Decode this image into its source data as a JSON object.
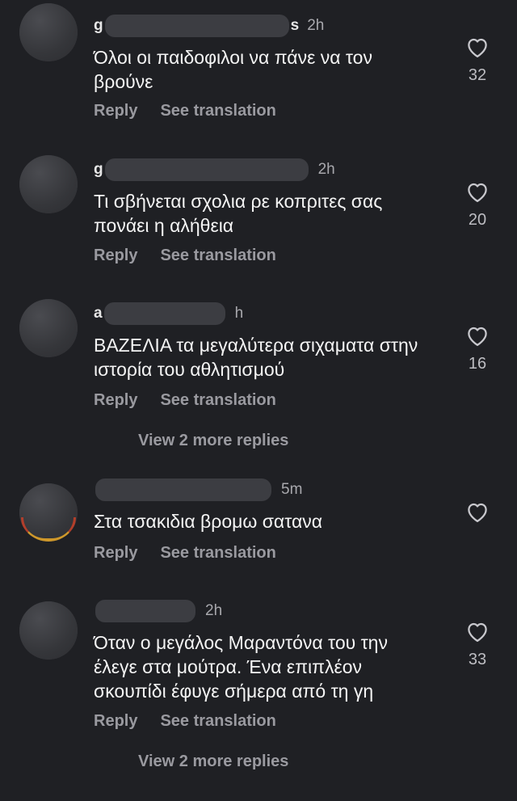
{
  "comments": [
    {
      "username_start": "g",
      "username_end": "s",
      "time": "2h",
      "text": "Όλοι οι παιδοφιλοι να πάνε να τον βρούνε",
      "reply": "Reply",
      "see_translation": "See translation",
      "likes": "32"
    },
    {
      "username_start": "g",
      "username_end": "",
      "time": "2h",
      "text": "Τι σβήνεται σχολια ρε κοπριτες σας πονάει η αλήθεια",
      "reply": "Reply",
      "see_translation": "See translation",
      "likes": "20"
    },
    {
      "username_start": "a",
      "username_end": "",
      "time": "h",
      "text": "ΒΑΖΕΛΙΑ τα μεγαλύτερα σιχαματα στην ιστορία του αθλητισμού",
      "reply": "Reply",
      "see_translation": "See translation",
      "likes": "16",
      "more_replies": "View 2 more replies"
    },
    {
      "username_start": "",
      "username_end": "",
      "time": "5m",
      "text": "Στα τσακιδια βρομω σατανα",
      "reply": "Reply",
      "see_translation": "See translation",
      "likes": ""
    },
    {
      "username_start": "",
      "username_end": "",
      "time": "2h",
      "text": "Όταν ο μεγάλος Μαραντόνα του την έλεγε στα μούτρα. Ένα επιπλέον σκουπίδι έφυγε σήμερα από τη γη",
      "reply": "Reply",
      "see_translation": "See translation",
      "likes": "33",
      "more_replies": "View 2 more replies"
    }
  ],
  "colors": {
    "background": "#1f2024",
    "text": "#f4f4f4",
    "secondary": "#9a9aa0"
  },
  "icons": {
    "like": "heart-outline-icon"
  }
}
